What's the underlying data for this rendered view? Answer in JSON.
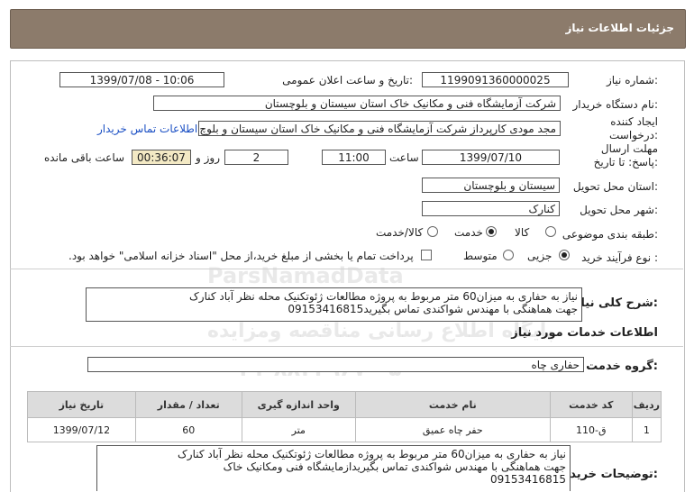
{
  "header": {
    "title": "جزئیات اطلاعات نیاز"
  },
  "labels": {
    "need_number": "شماره نیاز:",
    "announce_datetime": "تاریخ و ساعت اعلان عمومی:",
    "buyer_org": "نام دستگاه خریدار:",
    "creator": "ایجاد کننده درخواست:",
    "deadline": "مهلت ارسال پاسخ: تا تاریخ:",
    "time": "ساعت",
    "day_and": "روز و",
    "remaining": "ساعت باقی مانده",
    "province": "استان محل تحویل:",
    "city": "شهر محل تحویل:",
    "category": "طبقه بندی موضوعی:",
    "purchase_type": "نوع فرآیند خرید :",
    "summary": "شرح کلی نیاز:",
    "services_section": "اطلاعات خدمات مورد نیاز",
    "service_group": "گروه خدمت:",
    "buyer_notes": "توضیحات خریدار:"
  },
  "fields": {
    "need_number": "1199091360000025",
    "announce_datetime": "1399/07/08 - 10:06",
    "buyer_org": "شرکت آزمایشگاه فنی و مکانیک خاک استان سیستان و بلوچستان",
    "creator": "مجد مودی کارپرداز شرکت آزمایشگاه فنی و مکانیک خاک استان سیستان و بلوچ",
    "contact_link": "اطلاعات تماس خریدار",
    "deadline_date": "1399/07/10",
    "deadline_time": "11:00",
    "days": "2",
    "remaining_time": "00:36:07",
    "province": "سیستان و بلوچستان",
    "city": "کنارک",
    "service_group": "حفاری چاه"
  },
  "category_options": [
    {
      "label": "کالا",
      "selected": false
    },
    {
      "label": "خدمت",
      "selected": true
    },
    {
      "label": "کالا/خدمت",
      "selected": false
    }
  ],
  "purchase_options": [
    {
      "label": "جزیی",
      "selected": true
    },
    {
      "label": "متوسط",
      "selected": false
    }
  ],
  "treasury_note": "پرداخت تمام یا بخشی از مبلغ خرید،از محل \"اسناد خزانه اسلامی\" خواهد بود.",
  "summary_lines": [
    "نیاز به حفاری به میزان60 متر مربوط به پروژه مطالعات ژئوتکنیک محله نظر آباد کنارک",
    "جهت هماهنگی با مهندس شواکندی تماس بگیرید09153416815"
  ],
  "table": {
    "headers": [
      "ردیف",
      "کد خدمت",
      "نام خدمت",
      "واحد اندازه گیری",
      "تعداد / مقدار",
      "تاریخ نیاز"
    ],
    "rows": [
      {
        "row": "1",
        "code": "ق-110",
        "name": "حفر چاه عمیق",
        "unit": "متر",
        "qty": "60",
        "date": "1399/07/12"
      }
    ]
  },
  "notes_lines": [
    "نیاز به حفاری به میزان60 متر مربوط به پروژه مطالعات ژئوتکنیک محله نظر آباد کنارک",
    "جهت هماهنگی با مهندس شواکندی تماس بگیریدازمایشگاه فنی ومکانیک خاک",
    "09153416815"
  ],
  "watermark": {
    "brand": "ParsNamadData",
    "line1": "پایگاه اطلاع رسانی مناقصه ومزایده",
    "line2": "۰۲۱-۸۸۳۴۹۶۷۰-۵"
  }
}
